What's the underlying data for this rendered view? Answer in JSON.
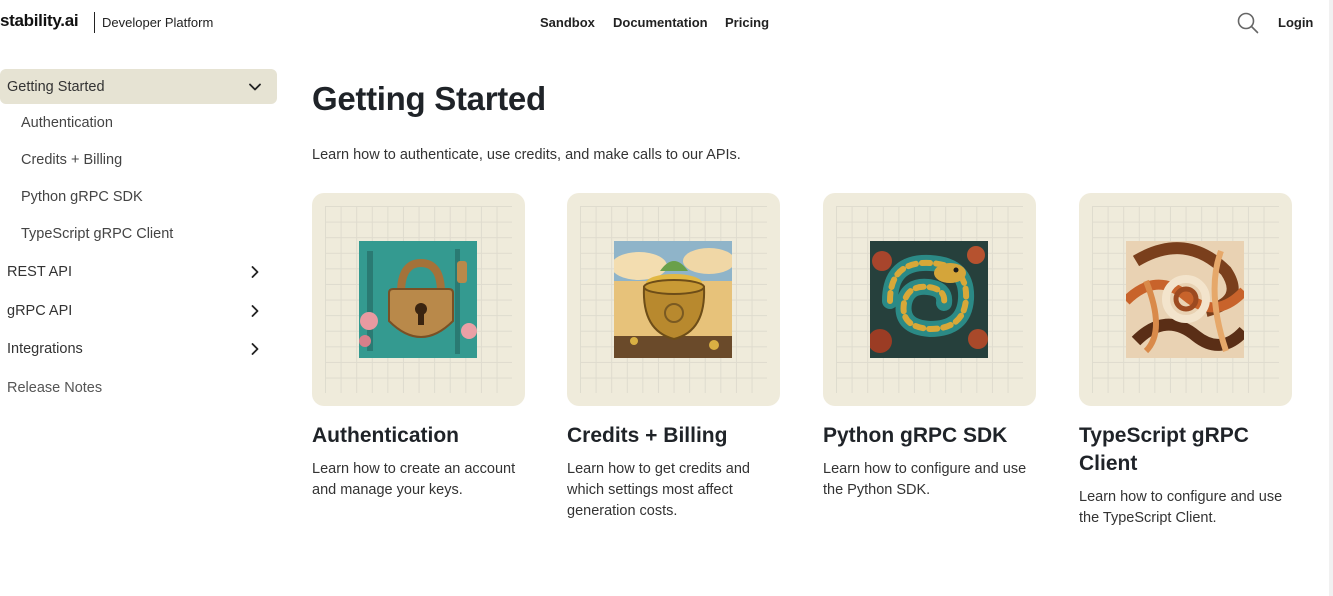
{
  "header": {
    "logo": "stability.ai",
    "platform": "Developer Platform",
    "nav": [
      "Sandbox",
      "Documentation",
      "Pricing"
    ],
    "login": "Login",
    "search_icon": "search-icon"
  },
  "sidebar": {
    "items": [
      {
        "label": "Getting Started",
        "active": true,
        "icon": "chevron-down-icon"
      },
      {
        "label": "Authentication"
      },
      {
        "label": "Credits + Billing"
      },
      {
        "label": "Python gRPC SDK"
      },
      {
        "label": "TypeScript gRPC Client"
      },
      {
        "label": "REST API",
        "icon": "chevron-right-icon"
      },
      {
        "label": "gRPC API",
        "icon": "chevron-right-icon"
      },
      {
        "label": "Integrations",
        "icon": "chevron-right-icon"
      },
      {
        "label": "Release Notes"
      }
    ]
  },
  "main": {
    "title": "Getting Started",
    "description": "Learn how to authenticate, use credits, and make calls to our APIs.",
    "cards": [
      {
        "title": "Authentication",
        "text": "Learn how to create an account and manage your keys."
      },
      {
        "title": "Credits + Billing",
        "text": "Learn how to get credits and which settings most affect generation costs."
      },
      {
        "title": "Python gRPC SDK",
        "text": "Learn how to configure and use the Python SDK."
      },
      {
        "title": "TypeScript gRPC Client",
        "text": "Learn how to configure and use the TypeScript Client."
      }
    ]
  },
  "colors": {
    "active_bg": "#e6e3d3",
    "card_bg": "#efebdb",
    "text": "#1f2328"
  }
}
